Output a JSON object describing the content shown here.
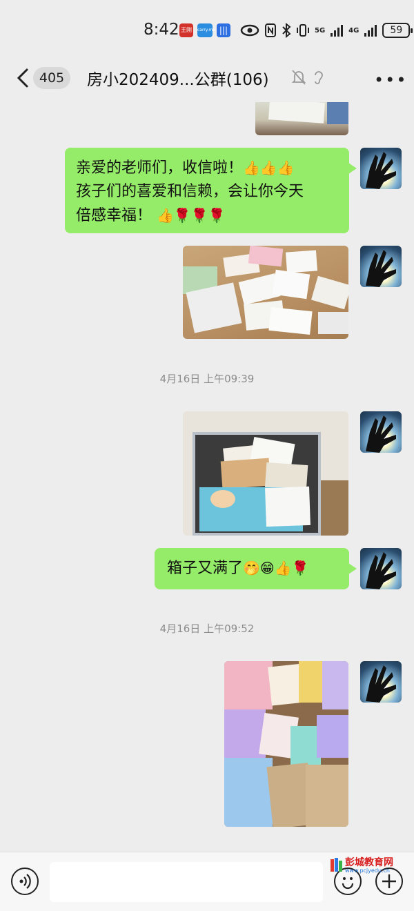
{
  "status_bar": {
    "time": "8:42",
    "badge1": "王刚",
    "badge2": "carry.me",
    "network1": "5G",
    "network2": "4G",
    "battery": "59"
  },
  "header": {
    "unread_count": "405",
    "title": "房小202409...公群(106)",
    "more_label": "•••"
  },
  "messages": [
    {
      "type": "image",
      "description_icon": "photo-top-partial"
    },
    {
      "type": "text",
      "lines": [
        "亲爱的老师们，收信啦！",
        "孩子们的喜爱和信赖，会让你今天",
        "倍感幸福！"
      ],
      "emoji_line1": "👍👍👍",
      "emoji_line3": "👍🌹🌹🌹"
    },
    {
      "type": "image",
      "description_icon": "photo-letters-on-table"
    },
    {
      "type": "time",
      "text": "4月16日 上午09:39"
    },
    {
      "type": "image",
      "description_icon": "photo-mailbox-full"
    },
    {
      "type": "text",
      "text": "箱子又满了",
      "emoji": "🤭😁👍🌹"
    },
    {
      "type": "time",
      "text": "4月16日 上午09:52"
    },
    {
      "type": "image",
      "description_icon": "photo-colorful-envelopes"
    }
  ],
  "input": {
    "placeholder": ""
  },
  "watermark": {
    "name": "彭城教育网",
    "url": "www.pcjyedu.cn"
  },
  "colors": {
    "bubble": "#95ec69",
    "background": "#ededed"
  }
}
